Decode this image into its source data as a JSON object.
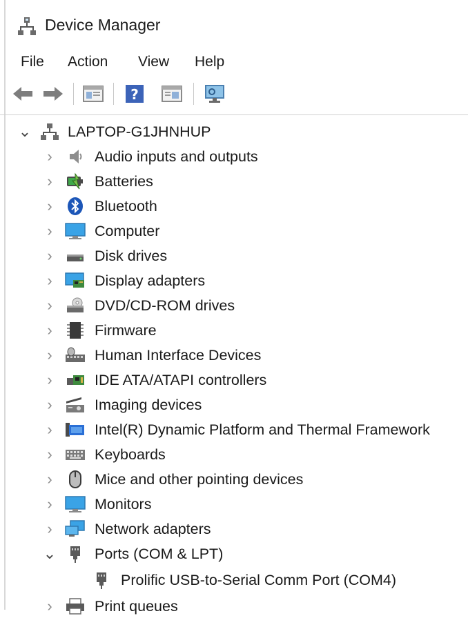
{
  "window": {
    "title": "Device Manager"
  },
  "menu": [
    "File",
    "Action",
    "View",
    "Help"
  ],
  "toolbar": [
    "back",
    "forward",
    "properties",
    "help",
    "show-hide-console-tree",
    "scan-hardware"
  ],
  "tree": {
    "root": "LAPTOP-G1JHNHUP",
    "categories": [
      "Audio inputs and outputs",
      "Batteries",
      "Bluetooth",
      "Computer",
      "Disk drives",
      "Display adapters",
      "DVD/CD-ROM drives",
      "Firmware",
      "Human Interface Devices",
      "IDE ATA/ATAPI controllers",
      "Imaging devices",
      "Intel(R) Dynamic Platform and Thermal Framework",
      "Keyboards",
      "Mice and other pointing devices",
      "Monitors",
      "Network adapters",
      "Ports (COM & LPT)",
      "Print queues"
    ],
    "expanded": "Ports (COM & LPT)",
    "ports_children": [
      "Prolific USB-to-Serial Comm Port (COM4)"
    ]
  },
  "icons": {
    "root": "computer-network-icon",
    "categories": [
      "speaker-icon",
      "battery-icon",
      "bluetooth-icon",
      "computer-icon",
      "disk-drive-icon",
      "display-adapter-icon",
      "dvd-drive-icon",
      "firmware-icon",
      "hid-icon",
      "ide-controller-icon",
      "camera-icon",
      "chip-icon",
      "keyboard-icon",
      "mouse-icon",
      "monitor-icon",
      "network-icon",
      "port-icon",
      "printer-icon"
    ],
    "ports_child": "serial-port-icon"
  },
  "colors": {
    "accent_blue": "#2a6fd6",
    "bluetooth": "#1c56b8",
    "monitor": "#3aa3e6",
    "battery_green": "#3ea84a"
  }
}
